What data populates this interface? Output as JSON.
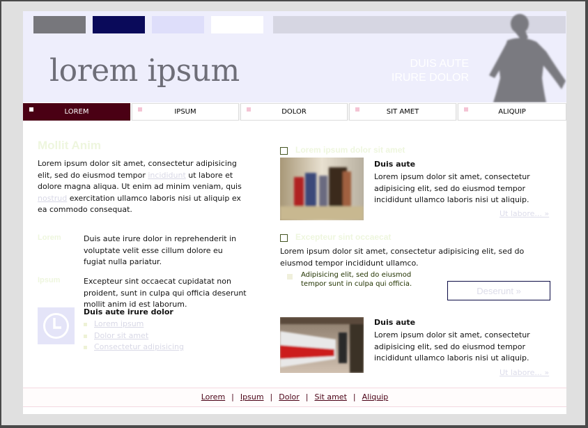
{
  "header": {
    "logo": "lorem ipsum",
    "tagline_line1": "DUIS AUTE",
    "tagline_line2": "IRURE DOLOR"
  },
  "nav": {
    "items": [
      {
        "label": "LOREM"
      },
      {
        "label": "IPSUM"
      },
      {
        "label": "DOLOR"
      },
      {
        "label": "SIT AMET"
      },
      {
        "label": "ALIQUIP"
      }
    ]
  },
  "left": {
    "heading": "Mollit Anim",
    "intro_a": "Lorem ipsum dolor sit amet, consectetur adipisicing elit, sed do eiusmod tempor ",
    "intro_link1": "incididunt",
    "intro_b": " ut labore et dolore magna aliqua. Ut enim ad minim veniam, quis ",
    "intro_link2": "nostrud",
    "intro_c": " exercitation ullamco laboris nisi ut aliquip ex ea commodo consequat.",
    "def1_term": "Lorem",
    "def1_text": "Duis aute irure dolor in reprehenderit in voluptate velit esse cillum dolore eu fugiat nulla pariatur.",
    "def2_term": "Ipsum",
    "def2_text": "Excepteur sint occaecat cupidatat non proident, sunt in culpa qui officia deserunt mollit anim id est laborum.",
    "list_title": "Duis aute irure dolor",
    "list_items": [
      "Lorem ipsum",
      "Dolor sit amet",
      "Consectetur adipisicing"
    ]
  },
  "right": {
    "section1_title": "Lorem ipsum dolor sit amet",
    "article1_title": "Duis aute",
    "article1_text": "Lorem ipsum dolor sit amet, consectetur adipisicing elit, sed do eiusmod tempor incididunt ullamco laboris nisi ut aliquip.",
    "article1_link": "Ut labore... »",
    "section2_title": "Excepteur sint occaecat",
    "section2_text": "Lorem ipsum dolor sit amet, consectetur adipisicing elit, sed do eiusmod tempor incididunt ullamco.",
    "tip_text": "Adipisicing elit, sed do eiusmod tempor sunt in culpa qui officia.",
    "button_label": "Deserunt »",
    "article2_title": "Duis aute",
    "article2_text": "Lorem ipsum dolor sit amet, consectetur adipisicing elit, sed do eiusmod tempor incididunt ullamco laboris nisi ut aliquip.",
    "article2_link": "Ut labore... »"
  },
  "footer": {
    "links": [
      "Lorem",
      "Ipsum",
      "Dolor",
      "Sit amet",
      "Aliquip"
    ]
  },
  "colors": {
    "accent": "#4a0014",
    "header_bg": "#eeeefc",
    "nav_marker": "#f4c4d4",
    "green_heading": "#eef6de"
  },
  "icons": {
    "clock": "clock-icon",
    "silhouette": "woman-silhouette"
  }
}
